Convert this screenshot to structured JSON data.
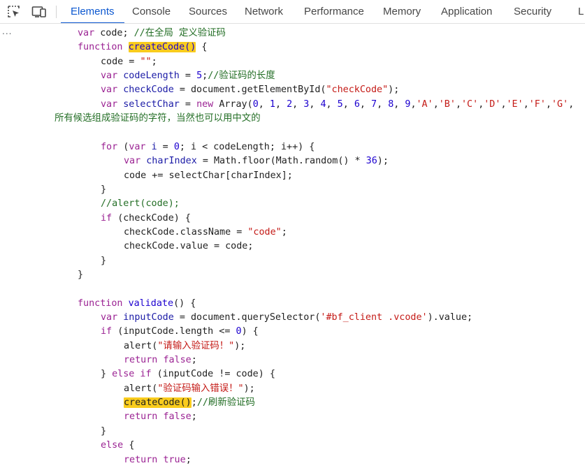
{
  "toolbar": {
    "inspect_icon": "inspect-element-icon",
    "device_icon": "device-toolbar-icon",
    "tabs": [
      {
        "label": "Elements",
        "active": true
      },
      {
        "label": "Console",
        "active": false
      },
      {
        "label": "Sources",
        "active": false
      },
      {
        "label": "Network",
        "active": false
      },
      {
        "label": "Performance",
        "active": false
      },
      {
        "label": "Memory",
        "active": false
      },
      {
        "label": "Application",
        "active": false
      },
      {
        "label": "Security",
        "active": false
      },
      {
        "label": "L",
        "active": false
      }
    ],
    "accent_color": "#0b57d0"
  },
  "gutter": {
    "ellipsis": "..."
  },
  "code": {
    "lines": [
      [
        [
          "var",
          "var"
        ],
        [
          "plain",
          " code; "
        ],
        [
          "com",
          "//在全局 定义验证码"
        ]
      ],
      [
        [
          "kw",
          "function "
        ],
        [
          "hlfn",
          "createCode()"
        ],
        [
          "plain",
          " {"
        ]
      ],
      [
        [
          "plain",
          "code = "
        ],
        [
          "str",
          "\"\""
        ],
        [
          "plain",
          ";"
        ]
      ],
      [
        [
          "kw",
          "var "
        ],
        [
          "var",
          "codeLength"
        ],
        [
          "plain",
          " = "
        ],
        [
          "num",
          "5"
        ],
        [
          "plain",
          ";"
        ],
        [
          "com",
          "//验证码的长度"
        ]
      ],
      [
        [
          "kw",
          "var "
        ],
        [
          "var",
          "checkCode"
        ],
        [
          "plain",
          " = document.getElementById("
        ],
        [
          "str",
          "\"checkCode\""
        ],
        [
          "plain",
          ");"
        ]
      ],
      [
        [
          "kw",
          "var "
        ],
        [
          "var",
          "selectChar"
        ],
        [
          "plain",
          " = "
        ],
        [
          "kw",
          "new "
        ],
        [
          "plain",
          "Array("
        ],
        [
          "num",
          "0"
        ],
        [
          "plain",
          ", "
        ],
        [
          "num",
          "1"
        ],
        [
          "plain",
          ", "
        ],
        [
          "num",
          "2"
        ],
        [
          "plain",
          ", "
        ],
        [
          "num",
          "3"
        ],
        [
          "plain",
          ", "
        ],
        [
          "num",
          "4"
        ],
        [
          "plain",
          ", "
        ],
        [
          "num",
          "5"
        ],
        [
          "plain",
          ", "
        ],
        [
          "num",
          "6"
        ],
        [
          "plain",
          ", "
        ],
        [
          "num",
          "7"
        ],
        [
          "plain",
          ", "
        ],
        [
          "num",
          "8"
        ],
        [
          "plain",
          ", "
        ],
        [
          "num",
          "9"
        ],
        [
          "plain",
          ","
        ],
        [
          "str",
          "'A'"
        ],
        [
          "plain",
          ","
        ],
        [
          "str",
          "'B'"
        ],
        [
          "plain",
          ","
        ],
        [
          "str",
          "'C'"
        ],
        [
          "plain",
          ","
        ],
        [
          "str",
          "'D'"
        ],
        [
          "plain",
          ","
        ],
        [
          "str",
          "'E'"
        ],
        [
          "plain",
          ","
        ],
        [
          "str",
          "'F'"
        ],
        [
          "plain",
          ","
        ],
        [
          "str",
          "'G'"
        ],
        [
          "plain",
          ","
        ]
      ],
      [
        [
          "com",
          "所有候选组成验证码的字符，当然也可以用中文的"
        ]
      ],
      [],
      [
        [
          "kw",
          "for "
        ],
        [
          "plain",
          "("
        ],
        [
          "kw",
          "var "
        ],
        [
          "var",
          "i"
        ],
        [
          "plain",
          " = "
        ],
        [
          "num",
          "0"
        ],
        [
          "plain",
          "; i < codeLength; i++) {"
        ]
      ],
      [
        [
          "kw",
          "var "
        ],
        [
          "var",
          "charIndex"
        ],
        [
          "plain",
          " = Math.floor(Math.random() * "
        ],
        [
          "num",
          "36"
        ],
        [
          "plain",
          ");"
        ]
      ],
      [
        [
          "plain",
          "code += selectChar[charIndex];"
        ]
      ],
      [
        [
          "plain",
          "}"
        ]
      ],
      [
        [
          "com",
          "//alert(code);"
        ]
      ],
      [
        [
          "kw",
          "if "
        ],
        [
          "plain",
          "(checkCode) {"
        ]
      ],
      [
        [
          "plain",
          "checkCode.className = "
        ],
        [
          "str",
          "\"code\""
        ],
        [
          "plain",
          ";"
        ]
      ],
      [
        [
          "plain",
          "checkCode.value = code;"
        ]
      ],
      [
        [
          "plain",
          "}"
        ]
      ],
      [
        [
          "plain",
          "}"
        ]
      ],
      [],
      [
        [
          "kw",
          "function "
        ],
        [
          "fn",
          "validate"
        ],
        [
          "plain",
          "() {"
        ]
      ],
      [
        [
          "kw",
          "var "
        ],
        [
          "var",
          "inputCode"
        ],
        [
          "plain",
          " = document.querySelector("
        ],
        [
          "str",
          "'#bf_client .vcode'"
        ],
        [
          "plain",
          ").value;"
        ]
      ],
      [
        [
          "kw",
          "if "
        ],
        [
          "plain",
          "(inputCode.length <= "
        ],
        [
          "num",
          "0"
        ],
        [
          "plain",
          ") {"
        ]
      ],
      [
        [
          "plain",
          "alert("
        ],
        [
          "str",
          "\"请输入验证码！\""
        ],
        [
          "plain",
          ");"
        ]
      ],
      [
        [
          "kw",
          "return "
        ],
        [
          "kw",
          "false"
        ],
        [
          "plain",
          ";"
        ]
      ],
      [
        [
          "plain",
          "} "
        ],
        [
          "kw",
          "else if "
        ],
        [
          "plain",
          "(inputCode != code) {"
        ]
      ],
      [
        [
          "plain",
          "alert("
        ],
        [
          "str",
          "\"验证码输入错误！\""
        ],
        [
          "plain",
          ");"
        ]
      ],
      [
        [
          "hlplain",
          "createCode()"
        ],
        [
          "plain",
          ";"
        ],
        [
          "com",
          "//刷新验证码"
        ]
      ],
      [
        [
          "kw",
          "return "
        ],
        [
          "kw",
          "false"
        ],
        [
          "plain",
          ";"
        ]
      ],
      [
        [
          "plain",
          "}"
        ]
      ],
      [
        [
          "kw",
          "else "
        ],
        [
          "plain",
          "{"
        ]
      ],
      [
        [
          "kw",
          "return "
        ],
        [
          "kw",
          "true"
        ],
        [
          "plain",
          ";"
        ]
      ]
    ]
  }
}
